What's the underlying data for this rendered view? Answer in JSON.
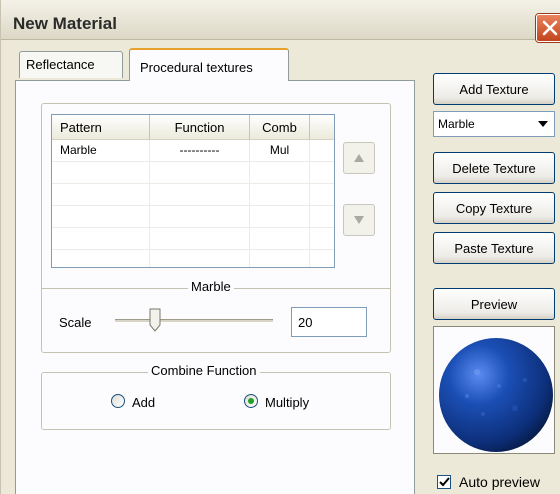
{
  "window": {
    "title": "New Material",
    "close_icon": "close-icon",
    "accent_close": "#c2451d"
  },
  "tabs": [
    {
      "label": "Reflectance",
      "active": false
    },
    {
      "label": "Procedural textures",
      "active": true
    }
  ],
  "pattern_table": {
    "columns": [
      "Pattern",
      "Function",
      "Comb",
      ""
    ],
    "rows": [
      [
        "Marble",
        "----------",
        "Mul",
        ""
      ],
      [
        "",
        "",
        "",
        ""
      ],
      [
        "",
        "",
        "",
        ""
      ],
      [
        "",
        "",
        "",
        ""
      ],
      [
        "",
        "",
        "",
        ""
      ],
      [
        "",
        "",
        "",
        ""
      ]
    ],
    "move_up_icon": "triangle-up-icon",
    "move_down_icon": "triangle-down-icon"
  },
  "marble_group": {
    "label": "Marble",
    "scale_label": "Scale",
    "scale_value": "20",
    "slider_fraction": 0.25
  },
  "combine_group": {
    "label": "Combine Function",
    "options": [
      {
        "label": "Add",
        "selected": false
      },
      {
        "label": "Multiply",
        "selected": true
      }
    ]
  },
  "right_panel": {
    "add_texture": "Add Texture",
    "texture_select_value": "Marble",
    "delete_texture": "Delete Texture",
    "copy_texture": "Copy Texture",
    "paste_texture": "Paste Texture",
    "preview": "Preview",
    "auto_preview_label": "Auto preview",
    "auto_preview_checked": true,
    "sphere_color": "#1b4fb5"
  }
}
